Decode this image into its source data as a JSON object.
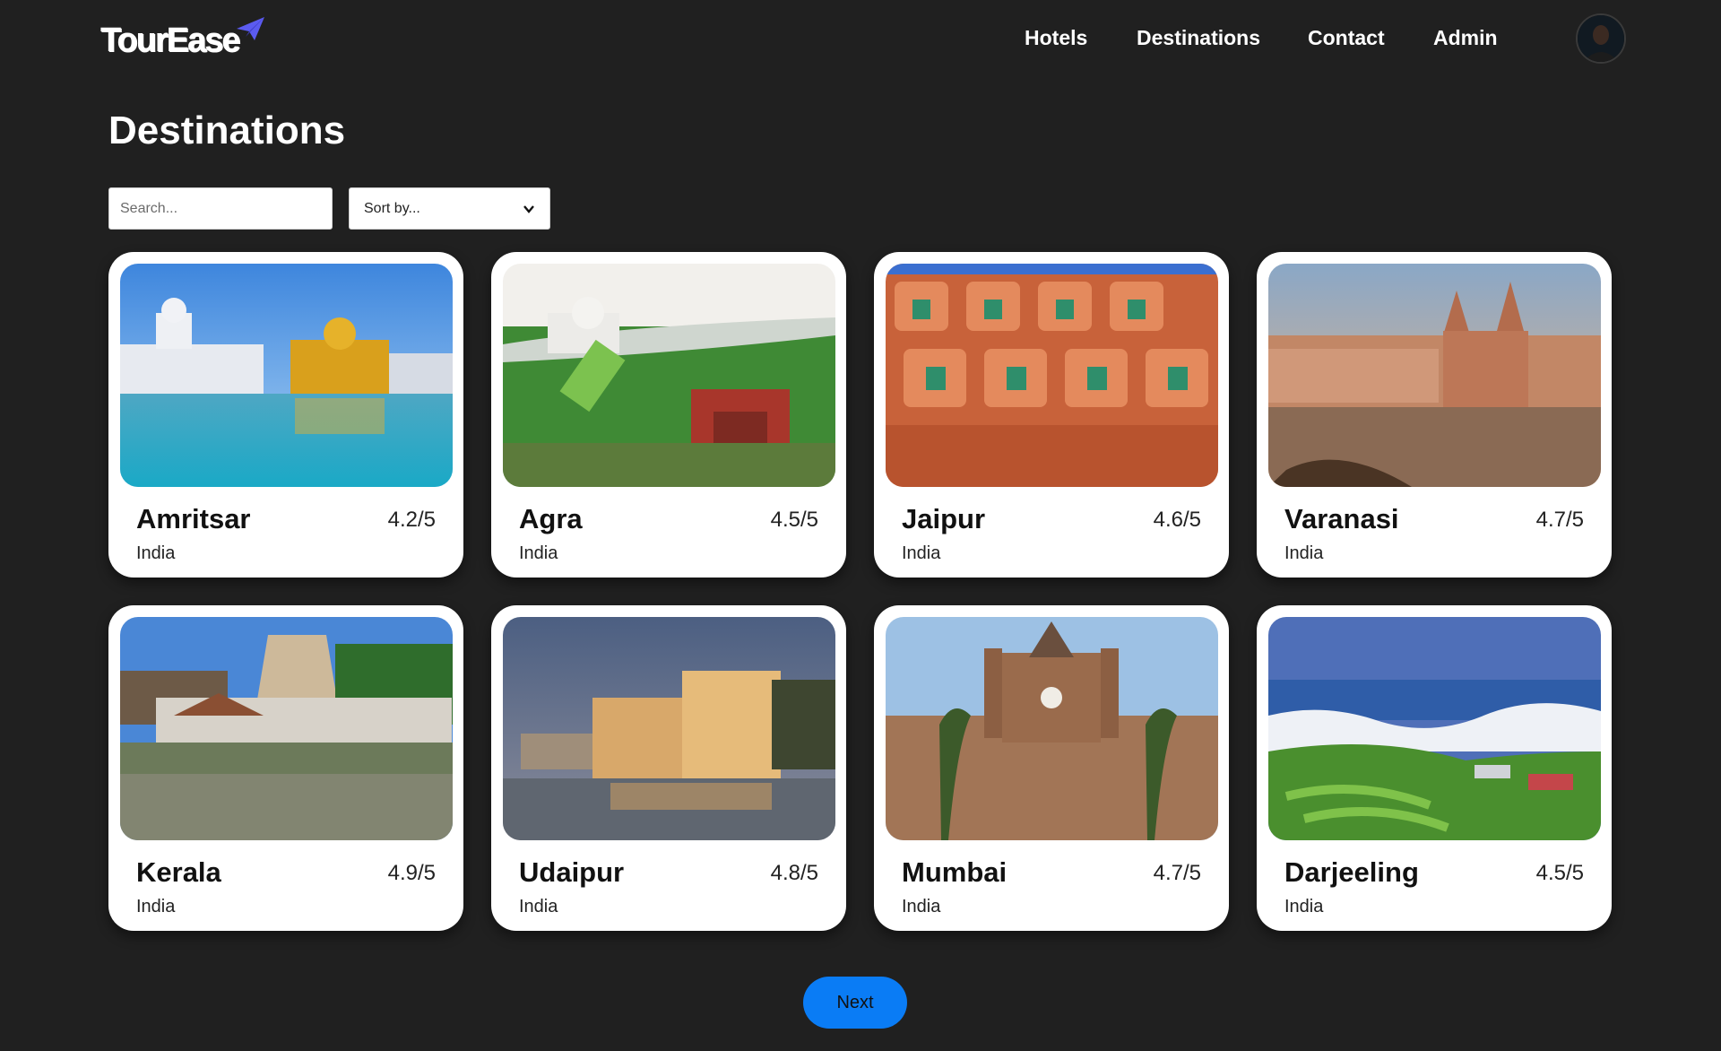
{
  "app": {
    "logo_text": "TourEase"
  },
  "nav": {
    "items": [
      {
        "label": "Hotels"
      },
      {
        "label": "Destinations"
      },
      {
        "label": "Contact"
      },
      {
        "label": "Admin"
      }
    ]
  },
  "page": {
    "title": "Destinations"
  },
  "filters": {
    "search_placeholder": "Search...",
    "sort_label": "Sort by..."
  },
  "destinations": [
    {
      "name": "Amritsar",
      "rating": "4.2/5",
      "country": "India"
    },
    {
      "name": "Agra",
      "rating": "4.5/5",
      "country": "India"
    },
    {
      "name": "Jaipur",
      "rating": "4.6/5",
      "country": "India"
    },
    {
      "name": "Varanasi",
      "rating": "4.7/5",
      "country": "India"
    },
    {
      "name": "Kerala",
      "rating": "4.9/5",
      "country": "India"
    },
    {
      "name": "Udaipur",
      "rating": "4.8/5",
      "country": "India"
    },
    {
      "name": "Mumbai",
      "rating": "4.7/5",
      "country": "India"
    },
    {
      "name": "Darjeeling",
      "rating": "4.5/5",
      "country": "India"
    }
  ],
  "pagination": {
    "next_label": "Next"
  },
  "colors": {
    "background": "#202020",
    "accent": "#0a7cf5",
    "card": "#ffffff"
  }
}
